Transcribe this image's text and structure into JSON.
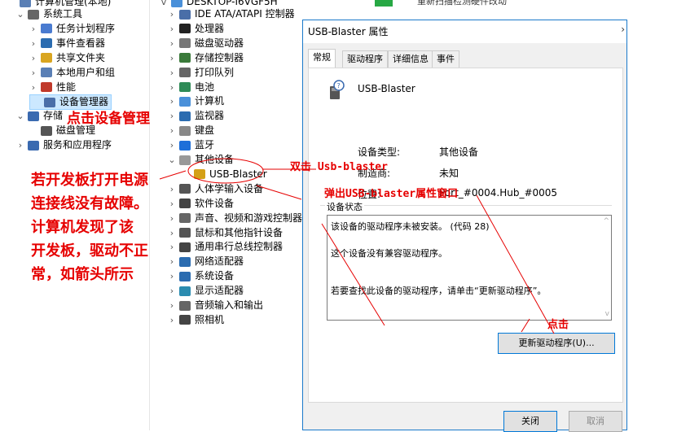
{
  "left_tree": {
    "top_cut": "计算机管理(本地)",
    "items": [
      {
        "label": "系统工具",
        "chev": "v",
        "icon": "#666"
      },
      {
        "label": "任务计划程序",
        "chev": ">",
        "icon": "#4a7bd0"
      },
      {
        "label": "事件查看器",
        "chev": ">",
        "icon": "#2b6cb0"
      },
      {
        "label": "共享文件夹",
        "chev": ">",
        "icon": "#d9a520"
      },
      {
        "label": "本地用户和组",
        "chev": ">",
        "icon": "#5a7fb5"
      },
      {
        "label": "性能",
        "chev": ">",
        "icon": "#c0392b"
      },
      {
        "label": "设备管理器",
        "chev": "",
        "icon": "#4a6ea8"
      },
      {
        "label": "存储",
        "chev": "v",
        "icon": "#3a6ab0"
      },
      {
        "label": "磁盘管理",
        "chev": "",
        "icon": "#555"
      },
      {
        "label": "服务和应用程序",
        "chev": ">",
        "icon": "#3a6ab0"
      }
    ]
  },
  "device_tree": {
    "top_cut": "DESKTOP-I6VGF5H",
    "items": [
      {
        "label": "IDE ATA/ATAPI 控制器",
        "chev": ">",
        "icon": "#4a6ea8"
      },
      {
        "label": "处理器",
        "chev": ">",
        "icon": "#222"
      },
      {
        "label": "磁盘驱动器",
        "chev": ">",
        "icon": "#777"
      },
      {
        "label": "存储控制器",
        "chev": ">",
        "icon": "#3a7a3a"
      },
      {
        "label": "打印队列",
        "chev": ">",
        "icon": "#666"
      },
      {
        "label": "电池",
        "chev": ">",
        "icon": "#2e8b57"
      },
      {
        "label": "计算机",
        "chev": ">",
        "icon": "#4a90d9"
      },
      {
        "label": "监视器",
        "chev": ">",
        "icon": "#2b6cb0"
      },
      {
        "label": "键盘",
        "chev": ">",
        "icon": "#888"
      },
      {
        "label": "蓝牙",
        "chev": ">",
        "icon": "#1e6fd9"
      },
      {
        "label": "其他设备",
        "chev": "v",
        "icon": "#999"
      },
      {
        "label": "USB-Blaster",
        "chev": "",
        "icon": "#d4a017"
      },
      {
        "label": "人体学输入设备",
        "chev": ">",
        "icon": "#555"
      },
      {
        "label": "软件设备",
        "chev": ">",
        "icon": "#444"
      },
      {
        "label": "声音、视频和游戏控制器",
        "chev": ">",
        "icon": "#666"
      },
      {
        "label": "鼠标和其他指针设备",
        "chev": ">",
        "icon": "#555"
      },
      {
        "label": "通用串行总线控制器",
        "chev": ">",
        "icon": "#444"
      },
      {
        "label": "网络适配器",
        "chev": ">",
        "icon": "#2b6cb0"
      },
      {
        "label": "系统设备",
        "chev": ">",
        "icon": "#2b6cb0"
      },
      {
        "label": "显示适配器",
        "chev": ">",
        "icon": "#2b8cb0"
      },
      {
        "label": "音频输入和输出",
        "chev": ">",
        "icon": "#666"
      },
      {
        "label": "照相机",
        "chev": ">",
        "icon": "#444"
      }
    ]
  },
  "dialog": {
    "title": "USB-Blaster 属性",
    "tabs": [
      "常规",
      "驱动程序",
      "详细信息",
      "事件"
    ],
    "device_name": "USB-Blaster",
    "props": [
      {
        "k": "设备类型:",
        "v": "其他设备"
      },
      {
        "k": "制造商:",
        "v": "未知"
      },
      {
        "k": "位置:",
        "v": "Port_#0004.Hub_#0005"
      }
    ],
    "status_group": "设备状态",
    "status_lines": [
      "该设备的驱动程序未被安装。 (代码 28)",
      "这个设备没有兼容驱动程序。",
      "若要查找此设备的驱动程序，请单击“更新驱动程序”。"
    ],
    "update_button": "更新驱动程序(U)...",
    "close_button": "关闭",
    "cancel_button": "取消"
  },
  "annotations": {
    "click_devmgr": "点击设备管理",
    "dbl_click": "双击 Usb-blaster",
    "popup": "弹出USB-blaster属性窗口",
    "click": "点击",
    "note": [
      "若开发板打开电源",
      "连接线没有故障。",
      "计算机发现了该",
      "开发板，驱动不正",
      "常，如箭头所示"
    ]
  },
  "top_cut_right": "重新扫描检测硬件改动"
}
